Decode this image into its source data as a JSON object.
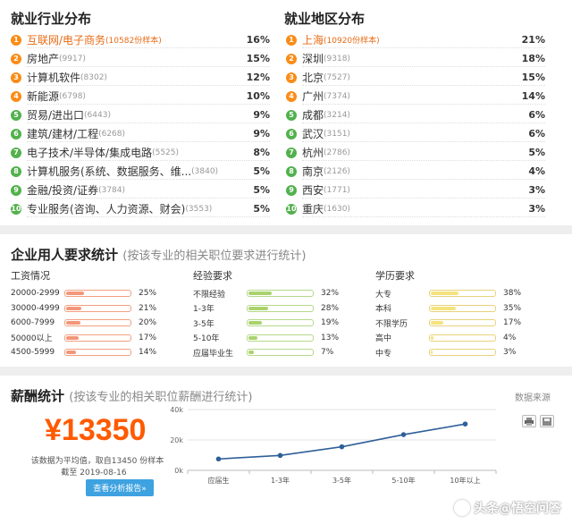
{
  "industry": {
    "title": "就业行业分布",
    "items": [
      {
        "rank": "1",
        "name": "互联网/电子商务",
        "count": "(10582份样本)",
        "pct": "16%"
      },
      {
        "rank": "2",
        "name": "房地产",
        "count": "(9917)",
        "pct": "15%"
      },
      {
        "rank": "3",
        "name": "计算机软件",
        "count": "(8302)",
        "pct": "12%"
      },
      {
        "rank": "4",
        "name": "新能源",
        "count": "(6798)",
        "pct": "10%"
      },
      {
        "rank": "5",
        "name": "贸易/进出口",
        "count": "(6443)",
        "pct": "9%"
      },
      {
        "rank": "6",
        "name": "建筑/建材/工程",
        "count": "(6268)",
        "pct": "9%"
      },
      {
        "rank": "7",
        "name": "电子技术/半导体/集成电路",
        "count": "(5525)",
        "pct": "8%"
      },
      {
        "rank": "8",
        "name": "计算机服务(系统、数据服务、维...",
        "count": "(3840)",
        "pct": "5%"
      },
      {
        "rank": "9",
        "name": "金融/投资/证券",
        "count": "(3784)",
        "pct": "5%"
      },
      {
        "rank": "10",
        "name": "专业服务(咨询、人力资源、财会)",
        "count": "(3553)",
        "pct": "5%"
      }
    ]
  },
  "region": {
    "title": "就业地区分布",
    "items": [
      {
        "rank": "1",
        "name": "上海",
        "count": "(10920份样本)",
        "pct": "21%"
      },
      {
        "rank": "2",
        "name": "深圳",
        "count": "(9318)",
        "pct": "18%"
      },
      {
        "rank": "3",
        "name": "北京",
        "count": "(7527)",
        "pct": "15%"
      },
      {
        "rank": "4",
        "name": "广州",
        "count": "(7374)",
        "pct": "14%"
      },
      {
        "rank": "5",
        "name": "成都",
        "count": "(3214)",
        "pct": "6%"
      },
      {
        "rank": "6",
        "name": "武汉",
        "count": "(3151)",
        "pct": "6%"
      },
      {
        "rank": "7",
        "name": "杭州",
        "count": "(2786)",
        "pct": "5%"
      },
      {
        "rank": "8",
        "name": "南京",
        "count": "(2126)",
        "pct": "4%"
      },
      {
        "rank": "9",
        "name": "西安",
        "count": "(1771)",
        "pct": "3%"
      },
      {
        "rank": "10",
        "name": "重庆",
        "count": "(1630)",
        "pct": "3%"
      }
    ]
  },
  "requirements": {
    "title": "企业用人要求统计",
    "subtitle": "(按该专业的相关职位要求进行统计)",
    "salary": {
      "title": "工资情况",
      "rows": [
        {
          "label": "20000-2999",
          "pct": "25%",
          "value": 25
        },
        {
          "label": "30000-4999",
          "pct": "21%",
          "value": 21
        },
        {
          "label": "6000-7999",
          "pct": "20%",
          "value": 20
        },
        {
          "label": "50000以上",
          "pct": "17%",
          "value": 17
        },
        {
          "label": "4500-5999",
          "pct": "14%",
          "value": 14
        }
      ]
    },
    "experience": {
      "title": "经验要求",
      "rows": [
        {
          "label": "不限经验",
          "pct": "32%",
          "value": 32
        },
        {
          "label": "1-3年",
          "pct": "28%",
          "value": 28
        },
        {
          "label": "3-5年",
          "pct": "19%",
          "value": 19
        },
        {
          "label": "5-10年",
          "pct": "13%",
          "value": 13
        },
        {
          "label": "应届毕业生",
          "pct": "7%",
          "value": 7
        }
      ]
    },
    "education": {
      "title": "学历要求",
      "rows": [
        {
          "label": "大专",
          "pct": "38%",
          "value": 38
        },
        {
          "label": "本科",
          "pct": "35%",
          "value": 35
        },
        {
          "label": "不限学历",
          "pct": "17%",
          "value": 17
        },
        {
          "label": "高中",
          "pct": "4%",
          "value": 4
        },
        {
          "label": "中专",
          "pct": "3%",
          "value": 3
        }
      ]
    }
  },
  "salary_stats": {
    "title": "薪酬统计",
    "subtitle": "(按该专业的相关职位薪酬进行统计)",
    "source_label": "数据来源",
    "amount": "¥13350",
    "note1": "该数据为平均值，取自13450 份样本",
    "note2": "截至 2019-08-16",
    "button_label": "查看分析报告»",
    "watermark": "头条@悟空问答"
  },
  "chart_data": {
    "type": "line",
    "categories": [
      "应届生",
      "1-3年",
      "3-5年",
      "5-10年",
      "10年以上"
    ],
    "y_tick_labels": [
      "40k",
      "20k",
      "0k"
    ],
    "ylim": [
      0,
      40000
    ],
    "series": [
      {
        "values": [
          7500,
          9800,
          15500,
          23500,
          30500
        ]
      }
    ],
    "line_color": "#2f5f98",
    "grid": true
  }
}
